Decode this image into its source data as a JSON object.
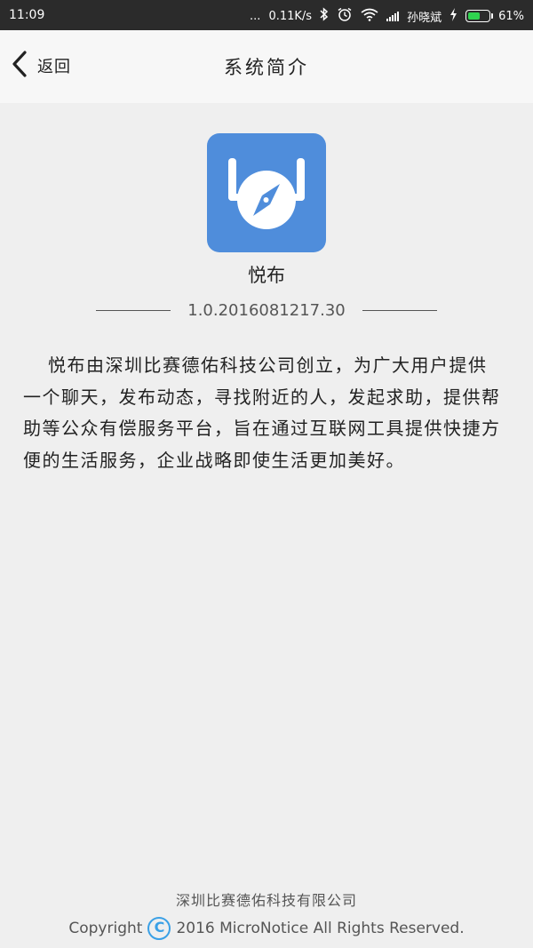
{
  "status_bar": {
    "time": "11:09",
    "dots": "...",
    "speed": "0.11K/s",
    "carrier": "孙晓斌",
    "battery_percent": "61%",
    "battery_level": 0.61,
    "icons": [
      "bluetooth-icon",
      "alarm-icon",
      "wifi-icon",
      "signal-icon",
      "charging-icon",
      "battery-icon"
    ]
  },
  "header": {
    "back_label": "返回",
    "title": "系统简介"
  },
  "app": {
    "name": "悦布",
    "version": "1.0.2016081217.30",
    "logo_color": "#4f8ddb"
  },
  "description": "悦布由深圳比赛德佑科技公司创立，为广大用户提供一个聊天，发布动态，寻找附近的人，发起求助，提供帮助等公众有偿服务平台，旨在通过互联网工具提供快捷方便的生活服务，企业战略即使生活更加美好。",
  "footer": {
    "company": "深圳比赛德佑科技有限公司",
    "copyright_prefix": "Copyright",
    "copyright_symbol": "C",
    "copyright_text": "2016 MicroNotice All Rights Reserved."
  }
}
